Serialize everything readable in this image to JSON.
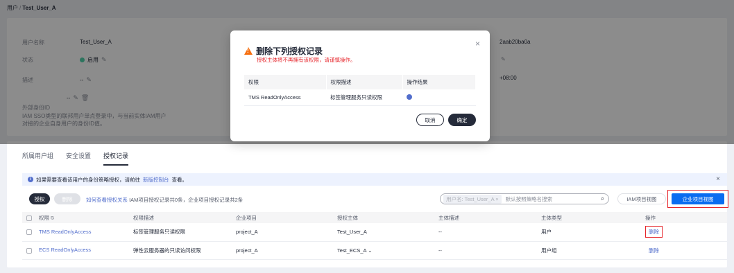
{
  "breadcrumb": {
    "parent": "用户",
    "current": "Test_User_A"
  },
  "info": {
    "username_label": "用户名称",
    "username_value": "Test_User_A",
    "status_label": "状态",
    "status_value": "启用",
    "desc_label": "描述",
    "desc_value": "--",
    "extid_label": "外部身份ID",
    "extid_value": "--",
    "extid_hint1": "IAM SSO类型的联邦用户单点登录中，与当前实体IAM用户",
    "extid_hint2": "对接的企业自身用户的身份ID值。",
    "right_id_partial": "2aab20ba0a",
    "right_tz_partial": "+08:00"
  },
  "dialog": {
    "title": "删除下列授权记录",
    "subtitle": "授权主体将不再拥有该权限，请谨慎操作。",
    "headers": [
      "权限",
      "权限描述",
      "操作结果"
    ],
    "rows": [
      {
        "permission": "TMS ReadOnlyAccess",
        "desc": "标签管理服务只读权限"
      }
    ],
    "cancel": "取消",
    "ok": "确定"
  },
  "tabs": [
    "所属用户组",
    "安全设置",
    "授权记录"
  ],
  "notice": {
    "text": "如果需要查看该用户的身份策略授权，请前往",
    "link": "新版控制台",
    "tail": "查看。"
  },
  "toolbar": {
    "grant": "授权",
    "delete": "删除",
    "how_link": "如何查看授权关系",
    "summary": "IAM项目授权记录共0条，企业项目授权记录共2条",
    "search_chip": "用户名: Test_User_A ×",
    "search_placeholder": "默认按照策略名搜索",
    "iam_view": "IAM项目视图",
    "ent_view": "企业项目视图"
  },
  "table": {
    "headers": [
      "权限",
      "权限描述",
      "企业项目",
      "授权主体",
      "主体描述",
      "主体类型",
      "操作"
    ],
    "rows": [
      {
        "perm": "TMS ReadOnlyAccess",
        "desc": "标签管理服务只读权限",
        "project": "project_A",
        "principal": "Test_User_A",
        "pdesc": "--",
        "ptype": "用户",
        "action": "删除"
      },
      {
        "perm": "ECS ReadOnlyAccess",
        "desc": "弹性云服务器的只读访问权限",
        "project": "project_A",
        "principal": "Test_ECS_A",
        "pdesc": "--",
        "ptype": "用户组",
        "action": "删除"
      }
    ]
  }
}
